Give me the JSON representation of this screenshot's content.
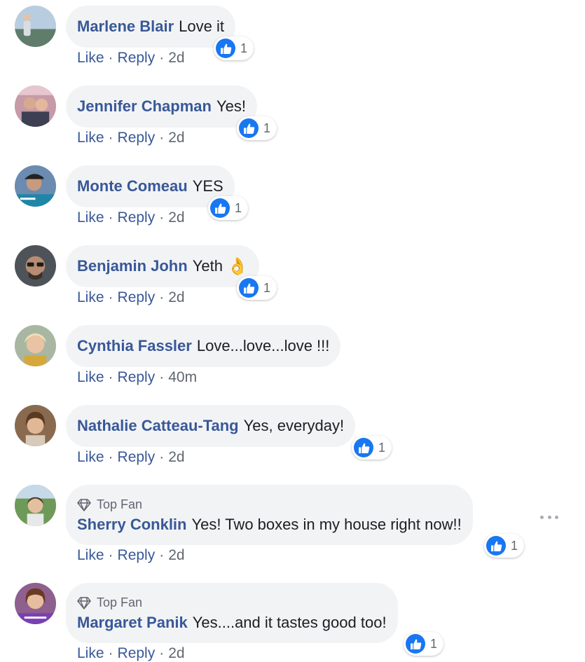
{
  "labels": {
    "like": "Like",
    "reply": "Reply",
    "separator": "·",
    "top_fan": "Top Fan"
  },
  "colors": {
    "name": "#385898",
    "bubble": "#f2f3f5",
    "like_blue": "#1877f2"
  },
  "comments": [
    {
      "author": "Marlene Blair",
      "text": "Love it",
      "time": "2d",
      "reactions": "1",
      "reaction_icon": "like-icon",
      "top_fan": false
    },
    {
      "author": "Jennifer Chapman",
      "text": "Yes!",
      "time": "2d",
      "reactions": "1",
      "reaction_icon": "like-icon",
      "top_fan": false
    },
    {
      "author": "Monte Comeau",
      "text": "YES",
      "time": "2d",
      "reactions": "1",
      "reaction_icon": "like-icon",
      "top_fan": false
    },
    {
      "author": "Benjamin John",
      "text": "Yeth",
      "emoji": "👌",
      "time": "2d",
      "reactions": "1",
      "reaction_icon": "like-icon",
      "top_fan": false
    },
    {
      "author": "Cynthia Fassler",
      "text": "Love...love...love !!!",
      "time": "40m",
      "reactions": "",
      "top_fan": false
    },
    {
      "author": "Nathalie Catteau-Tang",
      "text": "Yes, everyday!",
      "time": "2d",
      "reactions": "1",
      "reaction_icon": "like-icon",
      "top_fan": false
    },
    {
      "author": "Sherry Conklin",
      "text": "Yes! Two boxes in my house right now!!",
      "time": "2d",
      "reactions": "1",
      "reaction_icon": "like-icon",
      "top_fan": true
    },
    {
      "author": "Margaret Panik",
      "text": "Yes....and it tastes good too!",
      "time": "2d",
      "reactions": "1",
      "reaction_icon": "like-icon",
      "top_fan": true
    }
  ]
}
